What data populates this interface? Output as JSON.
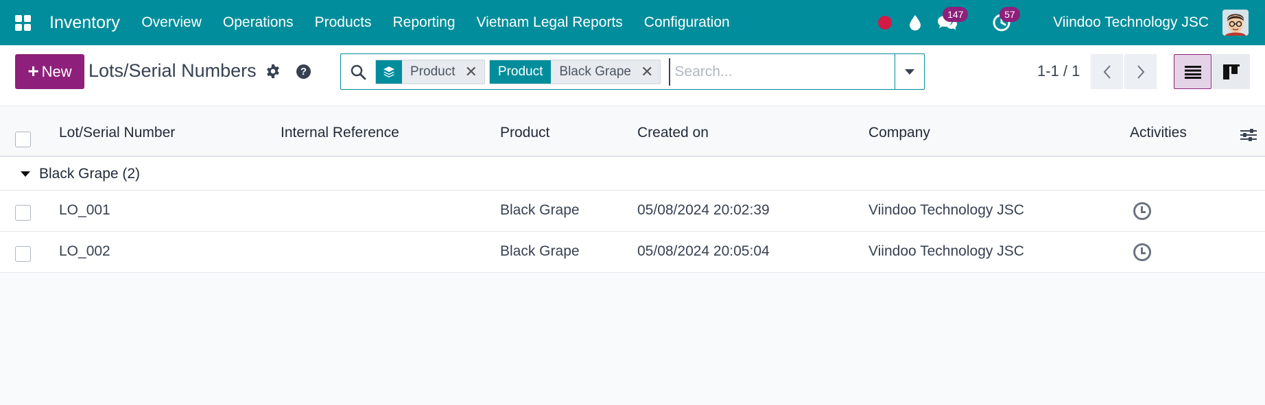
{
  "navbar": {
    "app_name": "Inventory",
    "menu": [
      "Overview",
      "Operations",
      "Products",
      "Reporting",
      "Vietnam Legal Reports",
      "Configuration"
    ],
    "messages_count": "147",
    "activities_count": "57",
    "company": "Viindoo Technology JSC"
  },
  "control": {
    "new_label": "New",
    "title": "Lots/Serial Numbers",
    "facets": [
      {
        "type_icon": "layers-icon",
        "value": "Product"
      },
      {
        "type_label": "Product",
        "value": "Black Grape"
      }
    ],
    "search_placeholder": "Search...",
    "pager": "1-1 / 1"
  },
  "list": {
    "columns": [
      "Lot/Serial Number",
      "Internal Reference",
      "Product",
      "Created on",
      "Company",
      "Activities"
    ],
    "group": {
      "label": "Black Grape (2)"
    },
    "rows": [
      {
        "lot": "LO_001",
        "ref": "",
        "product": "Black Grape",
        "created": "05/08/2024 20:02:39",
        "company": "Viindoo Technology JSC"
      },
      {
        "lot": "LO_002",
        "ref": "",
        "product": "Black Grape",
        "created": "05/08/2024 20:05:04",
        "company": "Viindoo Technology JSC"
      }
    ]
  },
  "colors": {
    "primary": "#018d9b",
    "accent": "#8e1f7b",
    "record": "#d21a45"
  }
}
